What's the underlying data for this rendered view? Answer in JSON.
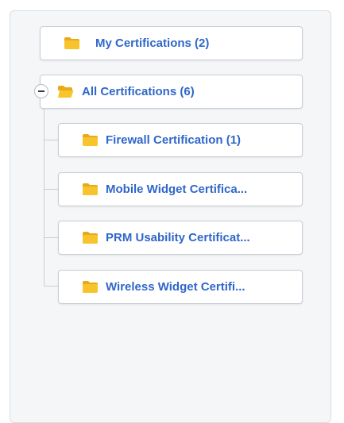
{
  "tree": {
    "my_certifications": {
      "label": "My Certifications (2)",
      "icon": "folder-icon"
    },
    "all_certifications": {
      "label": "All Certifications (6)",
      "icon": "folder-open-icon",
      "expanded": true,
      "toggle_icon": "collapse-minus-icon",
      "children": [
        {
          "label": "Firewall Certification (1)",
          "icon": "folder-icon"
        },
        {
          "label": "Mobile Widget Certifica...",
          "icon": "folder-icon"
        },
        {
          "label": "PRM Usability Certificat...",
          "icon": "folder-icon"
        },
        {
          "label": "Wireless Widget Certifi...",
          "icon": "folder-icon"
        }
      ]
    }
  },
  "colors": {
    "label": "#2f67c9",
    "folder": "#f7c52b",
    "panel_bg": "#f5f6f8",
    "node_border": "#c9ced6"
  }
}
